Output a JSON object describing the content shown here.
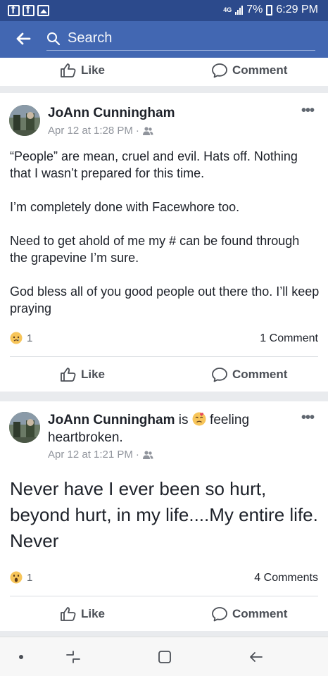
{
  "status_bar": {
    "network": "4G",
    "battery": "7%",
    "time": "6:29 PM"
  },
  "search": {
    "placeholder": "Search"
  },
  "actions": {
    "like": "Like",
    "comment": "Comment"
  },
  "posts": [
    {
      "author": "JoAnn Cunningham",
      "time": "Apr 12 at 1:28 PM",
      "paragraphs": [
        "“People” are mean, cruel and evil.  Hats off. Nothing that I wasn’t prepared for this time.",
        "I’m completely done with Facewhore too.",
        "Need to get ahold of me my # can be found through the grapevine I’m sure.",
        "God bless all of you good people out there tho. I’ll keep praying"
      ],
      "reaction_count": "1",
      "comment_count": "1 Comment"
    },
    {
      "author": "JoAnn Cunningham",
      "feeling_prefix": " is ",
      "feeling_suffix": " feeling",
      "feeling_second_line": "heartbroken.",
      "time": "Apr 12 at 1:21 PM",
      "text": "Never have I ever been so hurt, beyond hurt, in my life....My entire life. Never",
      "reaction_count": "1",
      "comment_count": "4 Comments"
    }
  ]
}
